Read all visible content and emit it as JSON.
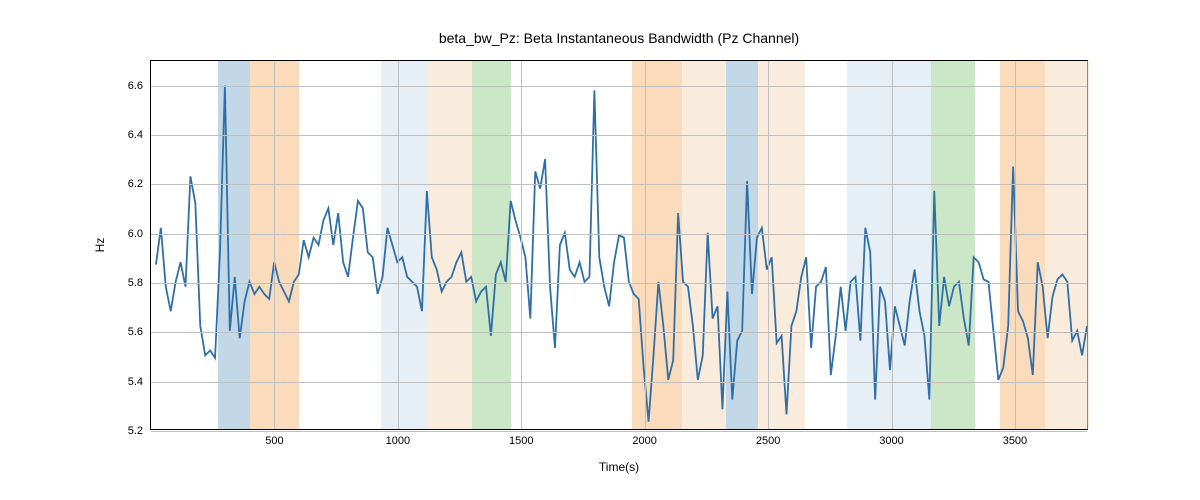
{
  "chart_data": {
    "type": "line",
    "title": "beta_bw_Pz: Beta Instantaneous Bandwidth (Pz Channel)",
    "xlabel": "Time(s)",
    "ylabel": "Hz",
    "xlim": [
      0,
      3800
    ],
    "ylim": [
      5.2,
      6.7
    ],
    "xticks": [
      500,
      1000,
      1500,
      2000,
      2500,
      3000,
      3500
    ],
    "yticks": [
      5.2,
      5.4,
      5.6,
      5.8,
      6.0,
      6.2,
      6.4,
      6.6
    ],
    "bands": [
      {
        "x0": 270,
        "x1": 400,
        "color": "#9abed6",
        "opacity": 0.6
      },
      {
        "x0": 400,
        "x1": 600,
        "color": "#f7c58f",
        "opacity": 0.6
      },
      {
        "x0": 930,
        "x1": 1120,
        "color": "#d6e2f0",
        "opacity": 0.6
      },
      {
        "x0": 1120,
        "x1": 1300,
        "color": "#f7e0c6",
        "opacity": 0.6
      },
      {
        "x0": 1300,
        "x1": 1460,
        "color": "#aad6a3",
        "opacity": 0.6
      },
      {
        "x0": 1950,
        "x1": 2150,
        "color": "#f7c58f",
        "opacity": 0.6
      },
      {
        "x0": 2150,
        "x1": 2330,
        "color": "#f7e0c6",
        "opacity": 0.6
      },
      {
        "x0": 2330,
        "x1": 2460,
        "color": "#9abed6",
        "opacity": 0.6
      },
      {
        "x0": 2460,
        "x1": 2650,
        "color": "#f7e0c6",
        "opacity": 0.6
      },
      {
        "x0": 2820,
        "x1": 3000,
        "color": "#d6e2f0",
        "opacity": 0.6
      },
      {
        "x0": 3000,
        "x1": 3160,
        "color": "#d6e2f0",
        "opacity": 0.6
      },
      {
        "x0": 3160,
        "x1": 3340,
        "color": "#aad6a3",
        "opacity": 0.6
      },
      {
        "x0": 3440,
        "x1": 3620,
        "color": "#f7c58f",
        "opacity": 0.6
      },
      {
        "x0": 3620,
        "x1": 3800,
        "color": "#f7e0c6",
        "opacity": 0.6
      }
    ],
    "series": [
      {
        "name": "beta_bw_Pz",
        "color": "#2f6fa8",
        "x": [
          20,
          40,
          60,
          80,
          100,
          120,
          140,
          160,
          180,
          200,
          220,
          240,
          260,
          280,
          300,
          320,
          340,
          360,
          380,
          400,
          420,
          440,
          460,
          480,
          500,
          520,
          540,
          560,
          580,
          600,
          620,
          640,
          660,
          680,
          700,
          720,
          740,
          760,
          780,
          800,
          820,
          840,
          860,
          880,
          900,
          920,
          940,
          960,
          980,
          1000,
          1020,
          1040,
          1060,
          1080,
          1100,
          1120,
          1140,
          1160,
          1180,
          1200,
          1220,
          1240,
          1260,
          1280,
          1300,
          1320,
          1340,
          1360,
          1380,
          1400,
          1420,
          1440,
          1460,
          1480,
          1500,
          1520,
          1540,
          1560,
          1580,
          1600,
          1620,
          1640,
          1660,
          1680,
          1700,
          1720,
          1740,
          1760,
          1780,
          1800,
          1820,
          1840,
          1860,
          1880,
          1900,
          1920,
          1940,
          1960,
          1980,
          2000,
          2020,
          2040,
          2060,
          2080,
          2100,
          2120,
          2140,
          2160,
          2180,
          2200,
          2220,
          2240,
          2260,
          2280,
          2300,
          2320,
          2340,
          2360,
          2380,
          2400,
          2420,
          2440,
          2460,
          2480,
          2500,
          2520,
          2540,
          2560,
          2580,
          2600,
          2620,
          2640,
          2660,
          2680,
          2700,
          2720,
          2740,
          2760,
          2780,
          2800,
          2820,
          2840,
          2860,
          2880,
          2900,
          2920,
          2940,
          2960,
          2980,
          3000,
          3020,
          3040,
          3060,
          3080,
          3100,
          3120,
          3140,
          3160,
          3180,
          3200,
          3220,
          3240,
          3260,
          3280,
          3300,
          3320,
          3340,
          3360,
          3380,
          3400,
          3420,
          3440,
          3460,
          3480,
          3500,
          3520,
          3540,
          3560,
          3580,
          3600,
          3620,
          3640,
          3660,
          3680,
          3700,
          3720,
          3740,
          3760,
          3780,
          3800
        ],
        "values": [
          5.87,
          6.02,
          5.78,
          5.68,
          5.8,
          5.88,
          5.78,
          6.23,
          6.12,
          5.62,
          5.5,
          5.52,
          5.49,
          5.92,
          6.6,
          5.6,
          5.82,
          5.57,
          5.72,
          5.8,
          5.75,
          5.78,
          5.75,
          5.73,
          5.88,
          5.8,
          5.76,
          5.72,
          5.8,
          5.83,
          5.97,
          5.9,
          5.98,
          5.95,
          6.05,
          6.1,
          5.95,
          6.08,
          5.88,
          5.82,
          5.98,
          6.13,
          6.1,
          5.92,
          5.9,
          5.75,
          5.82,
          6.02,
          5.95,
          5.88,
          5.9,
          5.82,
          5.8,
          5.78,
          5.68,
          6.17,
          5.9,
          5.85,
          5.76,
          5.8,
          5.82,
          5.88,
          5.92,
          5.8,
          5.82,
          5.72,
          5.76,
          5.78,
          5.58,
          5.83,
          5.88,
          5.8,
          6.13,
          6.05,
          5.98,
          5.9,
          5.65,
          6.25,
          6.18,
          6.3,
          5.78,
          5.53,
          5.95,
          6.0,
          5.85,
          5.82,
          5.88,
          5.8,
          5.82,
          6.58,
          5.9,
          5.78,
          5.7,
          5.88,
          5.99,
          5.98,
          5.8,
          5.75,
          5.73,
          5.45,
          5.23,
          5.5,
          5.8,
          5.62,
          5.4,
          5.48,
          6.08,
          5.8,
          5.78,
          5.62,
          5.4,
          5.5,
          6.0,
          5.65,
          5.7,
          5.28,
          5.76,
          5.32,
          5.56,
          5.6,
          6.21,
          5.75,
          5.98,
          6.02,
          5.85,
          5.9,
          5.55,
          5.58,
          5.26,
          5.62,
          5.68,
          5.82,
          5.9,
          5.53,
          5.78,
          5.8,
          5.86,
          5.42,
          5.58,
          5.78,
          5.6,
          5.8,
          5.82,
          5.56,
          6.02,
          5.92,
          5.32,
          5.78,
          5.72,
          5.44,
          5.7,
          5.62,
          5.54,
          5.72,
          5.85,
          5.68,
          5.58,
          5.32,
          6.17,
          5.62,
          5.82,
          5.7,
          5.78,
          5.8,
          5.65,
          5.54,
          5.9,
          5.88,
          5.81,
          5.8,
          5.6,
          5.4,
          5.45,
          5.62,
          6.27,
          5.68,
          5.64,
          5.57,
          5.42,
          5.88,
          5.78,
          5.57,
          5.74,
          5.81,
          5.83,
          5.8,
          5.56,
          5.6,
          5.5,
          5.62
        ]
      }
    ]
  }
}
